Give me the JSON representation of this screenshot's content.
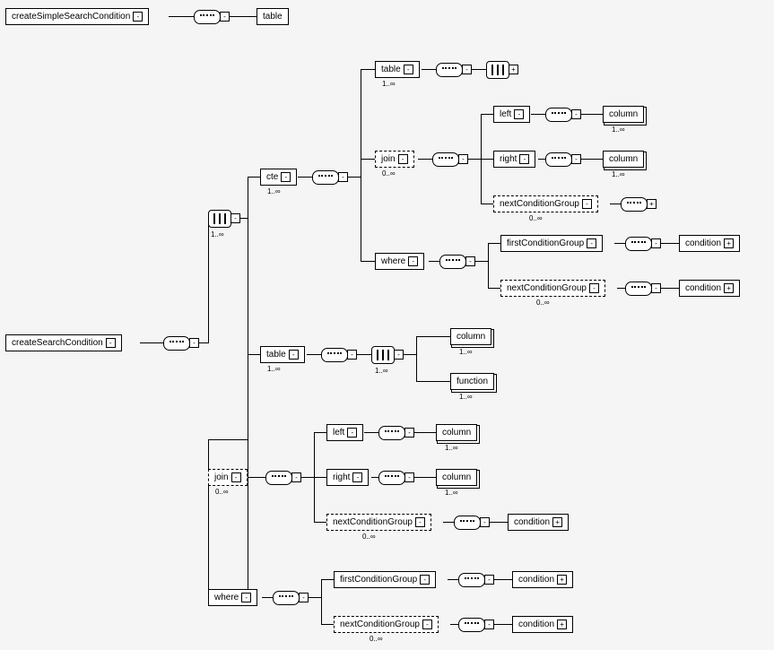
{
  "roots": {
    "simple": "createSimpleSearchCondition",
    "main": "createSearchCondition"
  },
  "labels": {
    "table": "table",
    "cte": "cte",
    "join": "join",
    "where": "where",
    "left": "left",
    "right": "right",
    "column": "column",
    "function": "function",
    "condition": "condition",
    "firstConditionGroup": "firstConditionGroup",
    "nextConditionGroup": "nextConditionGroup"
  },
  "card": {
    "one_inf": "1..∞",
    "zero_inf": "0..∞"
  }
}
